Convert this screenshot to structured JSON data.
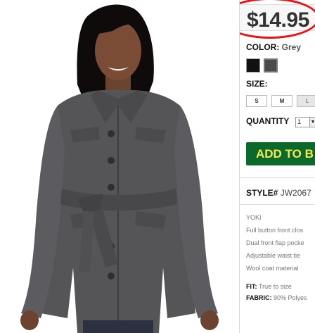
{
  "product": {
    "price": "$14.95",
    "color_label": "COLOR:",
    "color_value": "Grey",
    "size_label": "SIZE:",
    "sizes": [
      "S",
      "M",
      "L"
    ],
    "quantity_label": "QUANTITY",
    "quantity_value": "1",
    "add_button": "ADD TO B",
    "style_label": "STYLE#",
    "style_value": "JW2067",
    "details": [
      "YOKI",
      "Full button front clos",
      "Dual front flap pocke",
      "Adjustable waist tie",
      "Wool coat material"
    ],
    "fit_label": "FIT:",
    "fit_value": "True to size",
    "fabric_label": "FABRIC:",
    "fabric_value": "90% Polyes"
  },
  "colors": {
    "accent_button": "#0b6a2b",
    "button_text": "#ffe94a",
    "highlight_circle": "#e11111"
  }
}
